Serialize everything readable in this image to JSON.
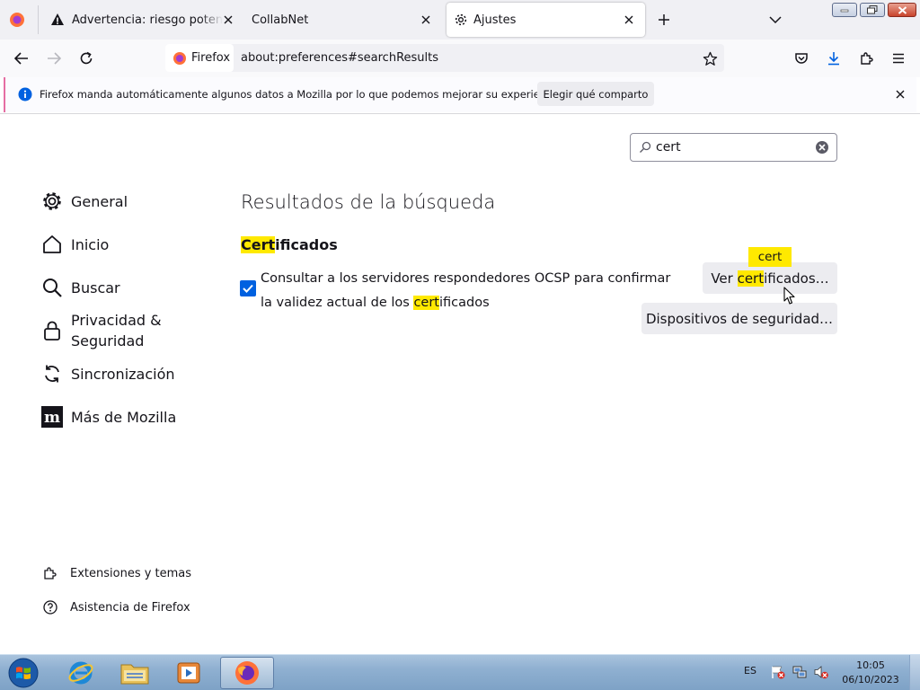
{
  "tabs": [
    {
      "label": "Advertencia: riesgo potencial de seguridad a continuación"
    },
    {
      "label": "CollabNet"
    },
    {
      "label": "Ajustes"
    }
  ],
  "urlbar": {
    "identity": "Firefox",
    "url": "about:preferences#searchResults"
  },
  "notification": {
    "message": "Firefox manda automáticamente algunos datos a Mozilla por lo que podemos mejorar su experiencia.",
    "button": "Elegir qué comparto"
  },
  "search": {
    "value": "cert"
  },
  "sidebar": {
    "items": [
      {
        "label": "General",
        "icon": "gear-icon"
      },
      {
        "label": "Inicio",
        "icon": "home-icon"
      },
      {
        "label": "Buscar",
        "icon": "search-icon"
      },
      {
        "label": "Privacidad &",
        "label2": "Seguridad",
        "icon": "lock-icon"
      },
      {
        "label": "Sincronización",
        "icon": "sync-icon"
      },
      {
        "label": "Más de Mozilla",
        "icon": "mozilla-icon"
      }
    ],
    "footer": [
      {
        "label": "Extensiones y temas",
        "icon": "puzzle-icon"
      },
      {
        "label": "Asistencia de Firefox",
        "icon": "help-icon"
      }
    ]
  },
  "main": {
    "heading": "Resultados de la búsqueda",
    "section": {
      "hl": "Cert",
      "rest": "ificados"
    },
    "checkbox": {
      "checked": true,
      "line1": "Consultar a los servidores respondedores OCSP para confirmar",
      "line2_pre": "la validez actual de los ",
      "line2_hl": "cert",
      "line2_post": "ificados"
    },
    "buttons": {
      "view_pre": "Ver ",
      "view_hl": "cert",
      "view_post": "ificados…",
      "devices": "Dispositivos de seguridad…"
    },
    "tooltip": "cert"
  },
  "taskbar": {
    "lang": "ES",
    "time": "10:05",
    "date": "06/10/2023"
  },
  "colors": {
    "accent": "#0061e0",
    "highlight": "#ffe900",
    "notification_border": "#e56ea3"
  }
}
